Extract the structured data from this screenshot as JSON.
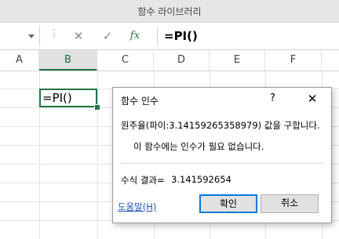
{
  "window": {
    "title": "함수 라이브러리"
  },
  "formula_bar": {
    "cancel_glyph": "✕",
    "enter_glyph": "✓",
    "fx_label": "fx",
    "formula": "=PI()"
  },
  "columns": [
    "A",
    "B",
    "C",
    "D",
    "E",
    "F"
  ],
  "selected_column": "B",
  "active_cell": {
    "value": "=PI()"
  },
  "dialog": {
    "title": "함수 인수",
    "help_glyph": "?",
    "close_glyph": "✕",
    "description": "원주율(파이:3.14159265358979) 값을 구합니다.",
    "args_note": "이 함수에는 인수가 필요 없습니다.",
    "result_label": "수식 결과=",
    "result_value": "3.141592654",
    "help_link": "도움말(H)",
    "ok_label": "확인",
    "cancel_label": "취소"
  },
  "colors": {
    "accent": "#217346",
    "link": "#1f4fb4",
    "focus": "#0078d7"
  }
}
